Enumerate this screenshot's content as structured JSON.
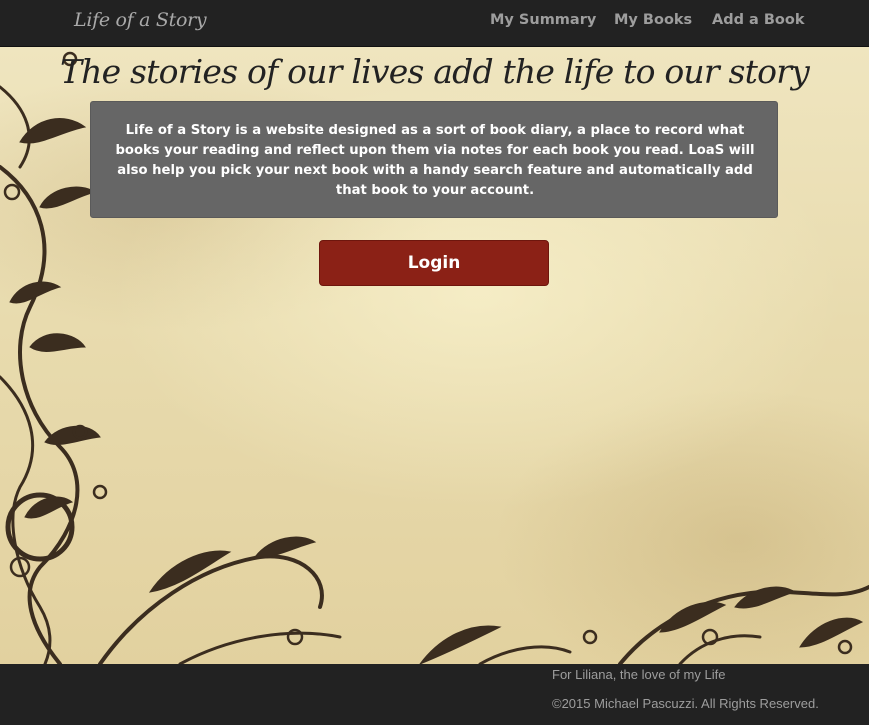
{
  "navbar": {
    "brand": "Life of a Story",
    "links": [
      {
        "label": "My Summary"
      },
      {
        "label": "My Books"
      },
      {
        "label": "Add a Book"
      }
    ]
  },
  "hero": {
    "tagline": "The stories of our lives add the life to our story",
    "intro": "Life of a Story is a website designed as a sort of book diary, a place to record what books your reading and reflect upon them via notes for each book you read. LoaS will also help you pick your next book with a handy search feature and automatically add that book to your account.",
    "login_label": "Login"
  },
  "footer": {
    "dedication": "For Liliana, the love of my Life",
    "copyright": "©2015 Michael Pascuzzi. All Rights Reserved."
  },
  "colors": {
    "navbar_bg": "#222222",
    "nav_text": "#9d9d9d",
    "parchment": "#e8dbae",
    "intro_box": "#666666",
    "login_button": "#8b2116",
    "swirl": "#3b2d1f"
  },
  "decoration": {
    "background": "parchment-texture",
    "ornament": "floral-swirl-vines"
  }
}
